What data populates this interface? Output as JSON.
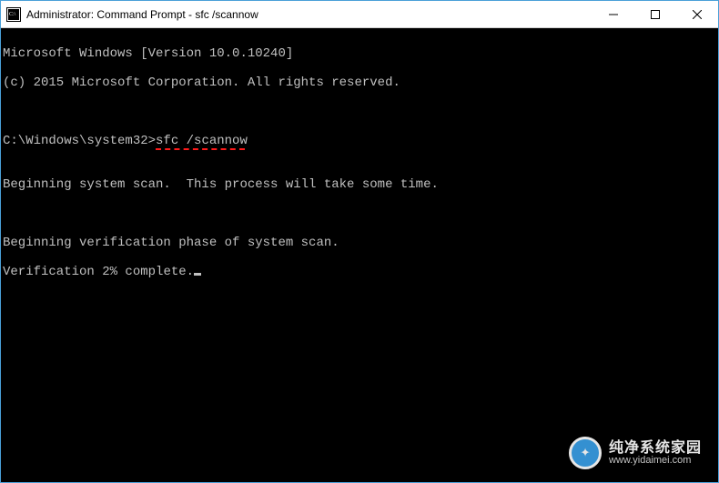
{
  "window": {
    "title": "Administrator: Command Prompt - sfc  /scannow"
  },
  "console": {
    "header_line": "Microsoft Windows [Version 10.0.10240]",
    "copyright_line": "(c) 2015 Microsoft Corporation. All rights reserved.",
    "prompt": "C:\\Windows\\system32>",
    "command": "sfc /scannow",
    "begin_scan_line": "Beginning system scan.  This process will take some time.",
    "begin_verify_line": "Beginning verification phase of system scan.",
    "verify_progress_prefix": "Verification ",
    "verify_percent": "2%",
    "verify_progress_suffix": " complete."
  },
  "watermark": {
    "name_cn": "纯净系统家园",
    "url": "www.yidaimei.com"
  },
  "colors": {
    "window_border": "#4aa0d8",
    "console_bg": "#000000",
    "console_fg": "#c0c0c0",
    "underline": "#ff1a1a"
  }
}
